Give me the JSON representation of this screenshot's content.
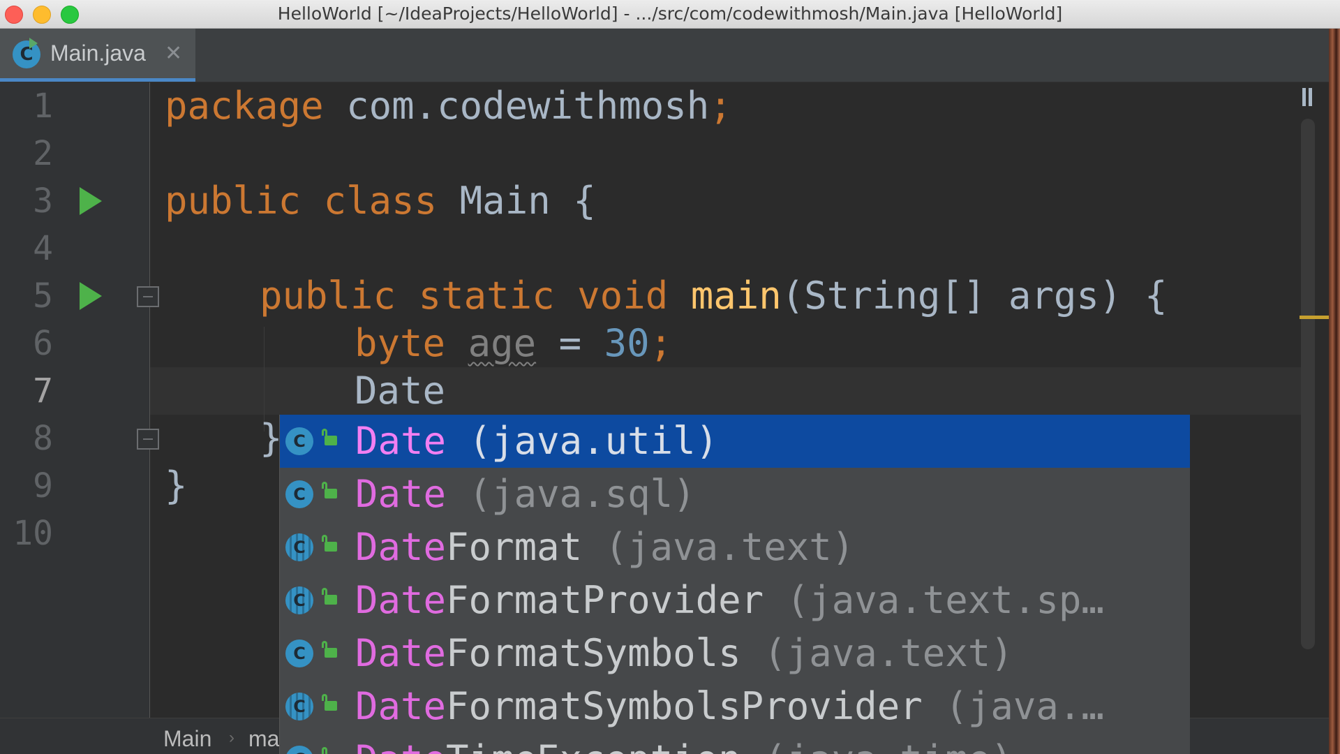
{
  "window": {
    "title": "HelloWorld [~/IdeaProjects/HelloWorld] - .../src/com/codewithmosh/Main.java [HelloWorld]"
  },
  "tabs": [
    {
      "label": "Main.java",
      "icon": "class-icon",
      "close": "✕",
      "active": true
    }
  ],
  "editor": {
    "line_numbers": [
      "1",
      "2",
      "3",
      "4",
      "5",
      "6",
      "7",
      "8",
      "9",
      "10"
    ],
    "current_line": "7",
    "lines": {
      "l1": {
        "kw": "package",
        "name": " com.codewithmosh",
        "semi": ";"
      },
      "l3": {
        "kw1": "public",
        "kw2": " class",
        "name": " Main {"
      },
      "l5": {
        "kw1": "public",
        "kw2": " static",
        "kw3": " void",
        "fn": " main",
        "rest": "(String[] args) {"
      },
      "l6": {
        "type": "byte",
        "var": "age",
        "op": " = ",
        "num": "30",
        "semi": ";"
      },
      "l7": {
        "text": "Date"
      },
      "l8": {
        "text": "}"
      },
      "l9": {
        "text": "}"
      }
    }
  },
  "completion": {
    "items": [
      {
        "match": "Date",
        "rest": "",
        "pkg": " (java.util)",
        "icon": "class-icon",
        "selected": true
      },
      {
        "match": "Date",
        "rest": "",
        "pkg": " (java.sql)",
        "icon": "class-icon",
        "selected": false
      },
      {
        "match": "Date",
        "rest": "Format",
        "pkg": " (java.text)",
        "icon": "abstract-class-icon",
        "selected": false
      },
      {
        "match": "Date",
        "rest": "FormatProvider",
        "pkg": " (java.text.sp…",
        "icon": "abstract-class-icon",
        "selected": false
      },
      {
        "match": "Date",
        "rest": "FormatSymbols",
        "pkg": " (java.text)",
        "icon": "class-icon",
        "selected": false
      },
      {
        "match": "Date",
        "rest": "FormatSymbolsProvider",
        "pkg": " (java.…",
        "icon": "abstract-class-icon",
        "selected": false
      },
      {
        "match": "Date",
        "rest": "TimeException",
        "pkg": " (java.time)",
        "icon": "class-icon",
        "selected": false
      }
    ]
  },
  "breadcrumb": {
    "items": [
      "Main",
      "ma"
    ],
    "separator": "›"
  },
  "colors": {
    "keyword": "#cc7832",
    "function": "#ffc66d",
    "number": "#6897bb",
    "selection": "#0d4aa0",
    "match": "#e06be0"
  }
}
